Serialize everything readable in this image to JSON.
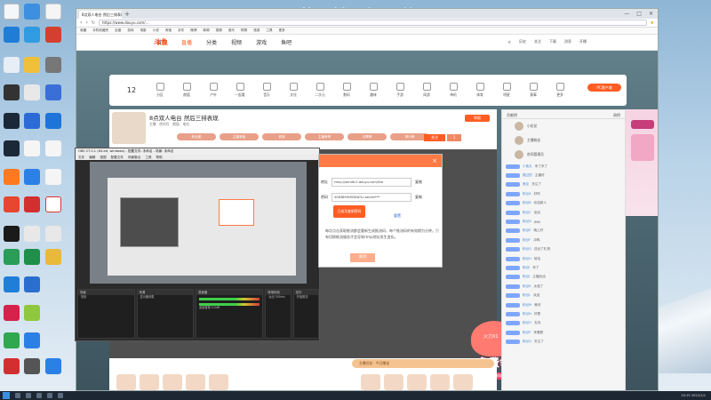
{
  "desktop": {
    "watermark": "黄  楼  知  信"
  },
  "browser": {
    "tab_title": "8点双人电台 然后三排表现",
    "new_tab_symbol": "+",
    "window_controls": [
      "—",
      "□",
      "✕"
    ],
    "url": "https://www.douyu.com/...",
    "bookmarks": [
      "收藏",
      "手机收藏夹",
      "百度",
      "游戏",
      "电影",
      "小说",
      "淘宝",
      "京东",
      "微博",
      "新闻",
      "视频",
      "音乐",
      "购物",
      "旅游",
      "工具",
      "更多"
    ]
  },
  "site": {
    "logo": "斗鱼",
    "nav": [
      "首页",
      "直播",
      "分类",
      "视频",
      "游戏",
      "鱼吧"
    ],
    "active_nav": "直播",
    "nav_right": [
      "历史",
      "关注",
      "下载",
      "消息",
      "开播"
    ]
  },
  "categories": {
    "count_label": "12",
    "items": [
      "分区",
      "颜值",
      "户外",
      "一起看",
      "音乐",
      "文化",
      "二次元",
      "数码",
      "趣味",
      "手游",
      "网游",
      "单机",
      "体育",
      "明星",
      "赛事",
      "更多"
    ],
    "pc_button": "PC客户端"
  },
  "room": {
    "title": "8点双人电台 然后三排表现",
    "tags": "主播 · 房间号 · 颜值 · 电台",
    "badges": [
      "粉丝团",
      "主播等级",
      "贵族",
      "主播荣誉",
      "月票榜",
      "排行榜"
    ],
    "report": "举报",
    "follow": "关注",
    "follow_count": "1"
  },
  "right_panel": {
    "header_left": "贡献榜",
    "header_right": "周榜",
    "ranks": [
      "小花花",
      "主播粉丝",
      "房间管理员"
    ],
    "chat": [
      [
        "小鱼丸",
        "来了来了"
      ],
      [
        "路过的",
        "主播好"
      ],
      [
        "鱼友",
        "关注了"
      ],
      [
        "粉丝A",
        "好听"
      ],
      [
        "粉丝B",
        "欢迎新人"
      ],
      [
        "粉丝C",
        "加油"
      ],
      [
        "粉丝D",
        "666"
      ],
      [
        "粉丝E",
        "晚上好"
      ],
      [
        "粉丝F",
        "冲鸭"
      ],
      [
        "粉丝G",
        "送出了礼物"
      ],
      [
        "粉丝H",
        "哈哈"
      ],
      [
        "粉丝I",
        "来了"
      ],
      [
        "粉丝J",
        "主播加油"
      ],
      [
        "粉丝K",
        "太强了"
      ],
      [
        "粉丝L",
        "欢迎"
      ],
      [
        "粉丝M",
        "晚安"
      ],
      [
        "粉丝N",
        "好看"
      ],
      [
        "粉丝O",
        "支持"
      ],
      [
        "粉丝P",
        "来看看"
      ],
      [
        "粉丝Q",
        "关注了"
      ]
    ]
  },
  "modal": {
    "close": "×",
    "server_label": "地址",
    "server_value": "rtmp://sendtc1.douyu.com/live",
    "key_label": "密码",
    "key_value": "5063899rMOKb?s=secret***",
    "copy": "复制",
    "toast": "已成功复制密码",
    "reset": "重置",
    "note": "每次点击获取推流都会重新生成推流码，每个推流码的有效期为分钟。只有切换推流服务才会导致rtmp地址发生变化。",
    "button": "关闭"
  },
  "promo": {
    "badge": "火力X1",
    "text": "免费领",
    "button": "立即领取",
    "ad_label": "广告"
  },
  "gift_bar": {
    "text": "主播任务 · 今日赠送"
  },
  "obs": {
    "title": "OBS 27.0.1 (64-bit, windows) - 配置文件: 未命名 - 场景: 未命名",
    "menu": [
      "文件",
      "编辑",
      "视图",
      "配置文件",
      "场景集合",
      "工具",
      "帮助"
    ],
    "docks": [
      "场景",
      "来源",
      "混音器",
      "转场特效",
      "控件"
    ],
    "dock_lines": [
      "场景",
      "显示器采集",
      "桌面音频  0.0dB",
      "淡出  300ms",
      "开始推流"
    ]
  },
  "taskbar": {
    "time": "10:15  2022/1/1"
  }
}
